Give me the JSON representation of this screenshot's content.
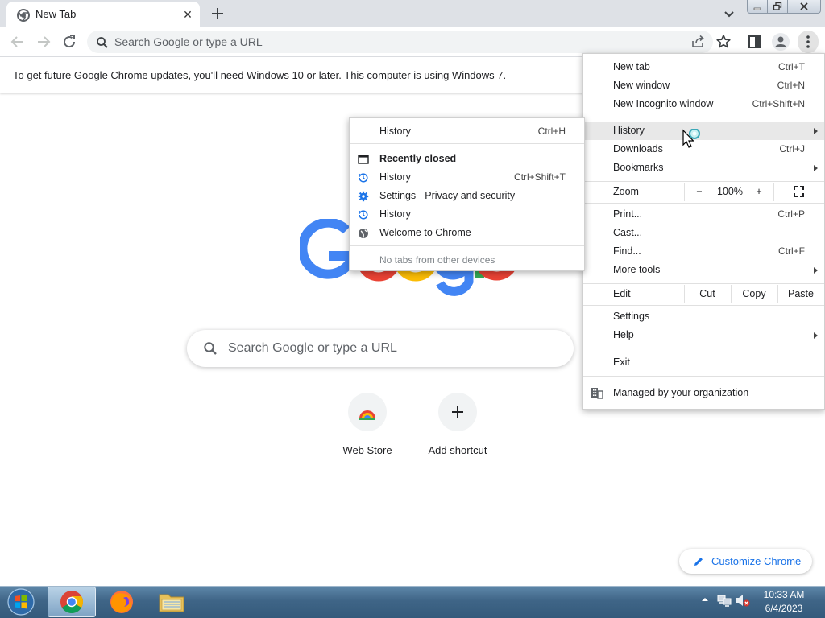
{
  "tab": {
    "title": "New Tab",
    "close_icon": "close-icon",
    "new_tab_icon": "plus-icon"
  },
  "toolbar": {
    "omnibox_placeholder": "Search Google or type a URL"
  },
  "infobar": {
    "message": "To get future Google Chrome updates, you'll need Windows 10 or later. This computer is using Windows 7."
  },
  "ntp": {
    "search_placeholder": "Search Google or type a URL",
    "shortcuts": [
      {
        "label": "Web Store"
      },
      {
        "label": "Add shortcut"
      }
    ],
    "customize_label": "Customize Chrome"
  },
  "main_menu": {
    "new_tab": {
      "label": "New tab",
      "shortcut": "Ctrl+T"
    },
    "new_window": {
      "label": "New window",
      "shortcut": "Ctrl+N"
    },
    "new_incognito": {
      "label": "New Incognito window",
      "shortcut": "Ctrl+Shift+N"
    },
    "history": {
      "label": "History"
    },
    "downloads": {
      "label": "Downloads",
      "shortcut": "Ctrl+J"
    },
    "bookmarks": {
      "label": "Bookmarks"
    },
    "zoom": {
      "label": "Zoom",
      "minus": "−",
      "level": "100%",
      "plus": "+"
    },
    "print": {
      "label": "Print...",
      "shortcut": "Ctrl+P"
    },
    "cast": {
      "label": "Cast..."
    },
    "find": {
      "label": "Find...",
      "shortcut": "Ctrl+F"
    },
    "more_tools": {
      "label": "More tools"
    },
    "edit": {
      "label": "Edit",
      "cut": "Cut",
      "copy": "Copy",
      "paste": "Paste"
    },
    "settings": {
      "label": "Settings"
    },
    "help": {
      "label": "Help"
    },
    "exit": {
      "label": "Exit"
    },
    "managed": {
      "label": "Managed by your organization"
    }
  },
  "history_menu": {
    "history": {
      "label": "History",
      "shortcut": "Ctrl+H"
    },
    "recently_closed": "Recently closed",
    "items": [
      {
        "label": "History",
        "shortcut": "Ctrl+Shift+T",
        "icon": "history-icon"
      },
      {
        "label": "Settings - Privacy and security",
        "shortcut": "",
        "icon": "gear-icon"
      },
      {
        "label": "History",
        "shortcut": "",
        "icon": "history-icon"
      },
      {
        "label": "Welcome to Chrome",
        "shortcut": "",
        "icon": "globe-icon"
      }
    ],
    "no_tabs": "No tabs from other devices"
  },
  "taskbar": {
    "time": "10:33 AM",
    "date": "6/4/2023"
  },
  "colors": {
    "accent": "#1a73e8",
    "highlight": "#e8e8e8",
    "google_blue": "#4285f4",
    "google_red": "#ea4335",
    "google_yellow": "#fbbc05",
    "google_green": "#34a853"
  }
}
